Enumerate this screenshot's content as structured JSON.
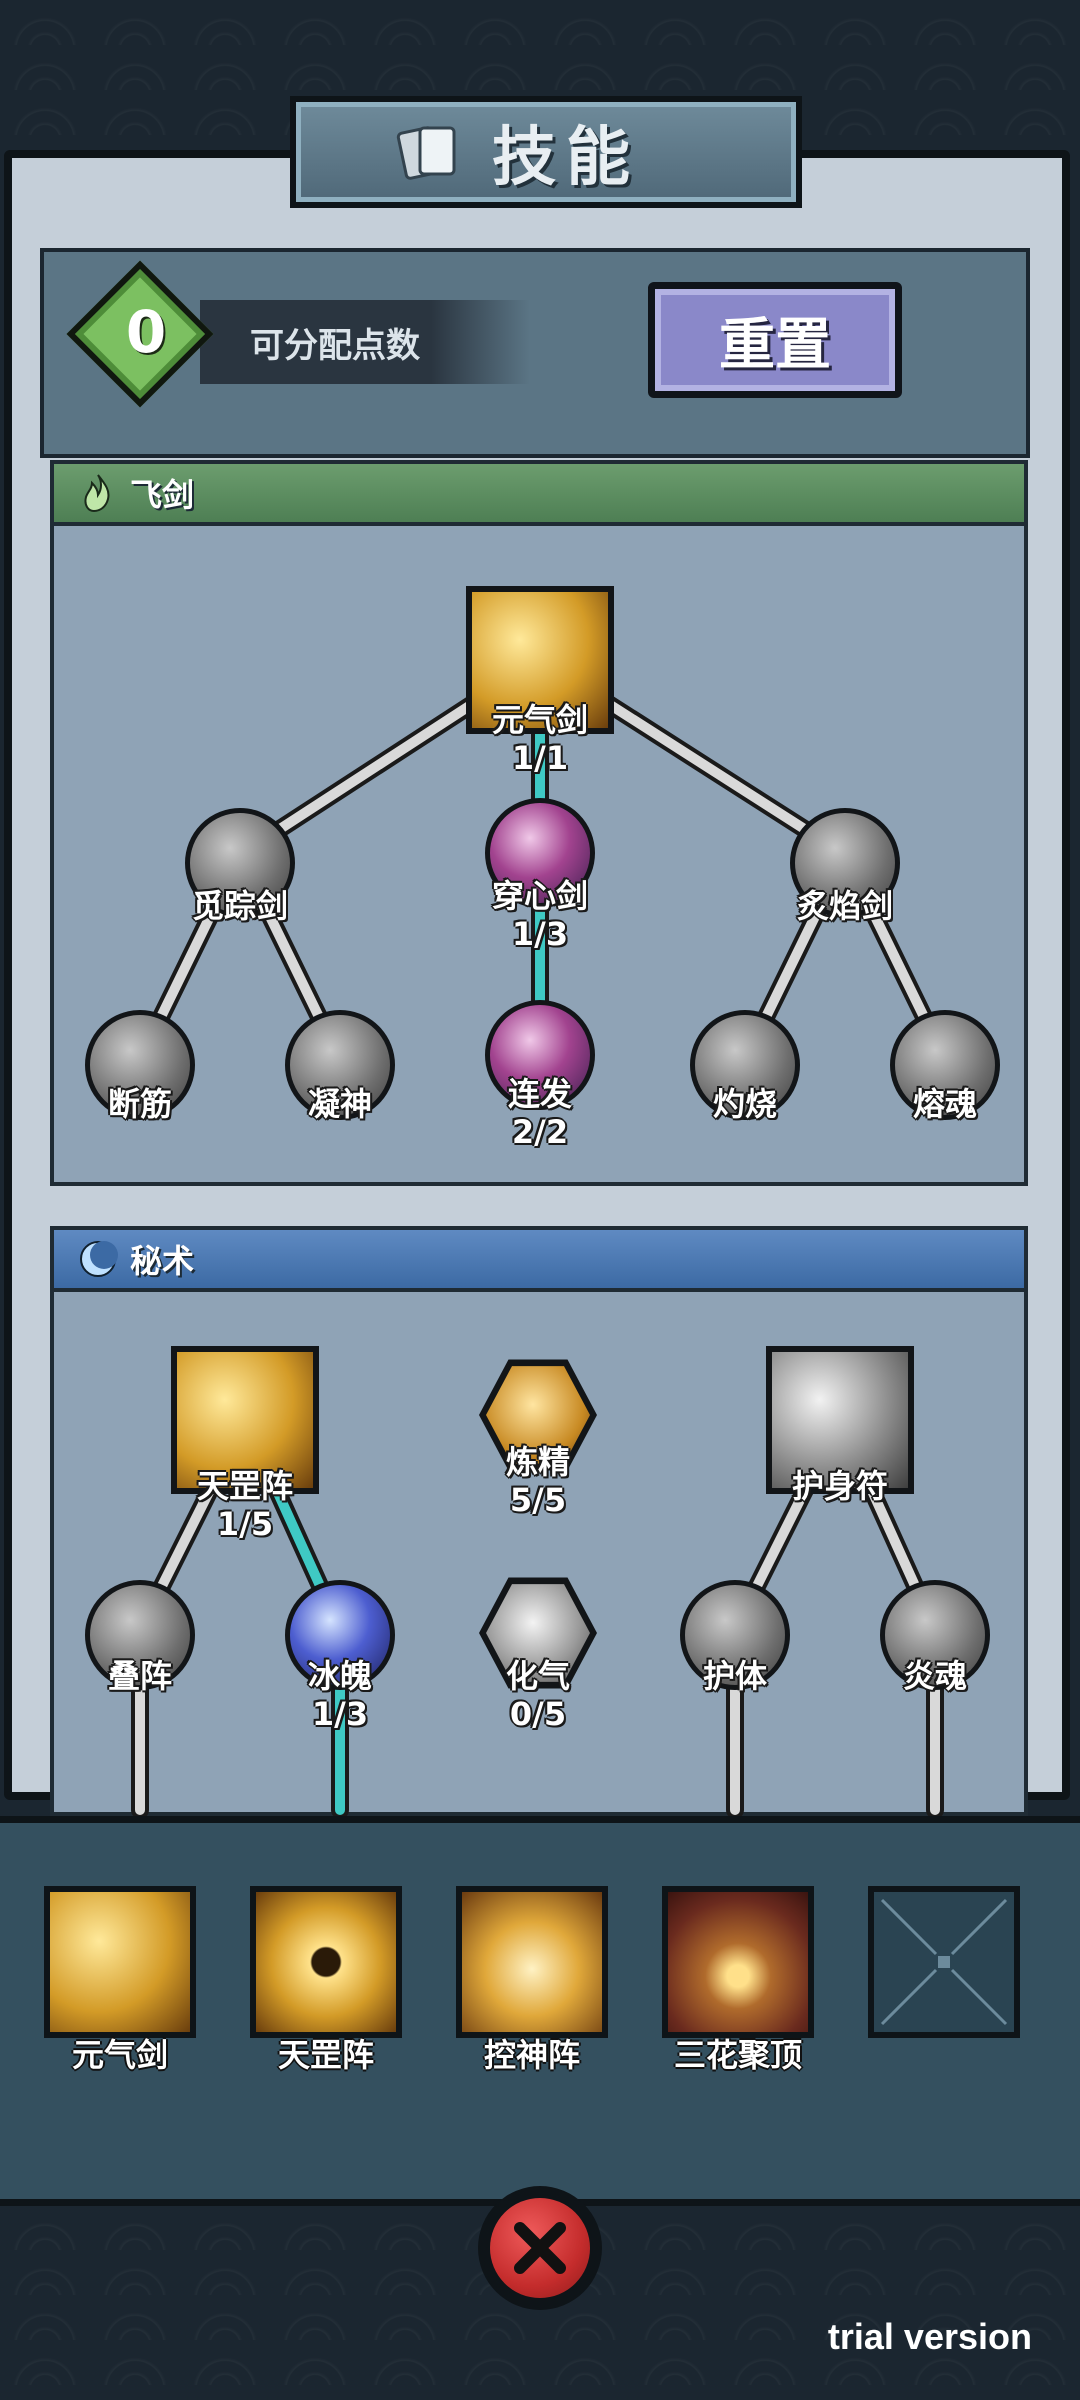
{
  "title": "技能",
  "points": {
    "value": "0",
    "label": "可分配点数"
  },
  "reset_label": "重置",
  "sections": {
    "flying_sword": {
      "title": "飞剑",
      "nodes": {
        "root": {
          "name": "元气剑",
          "level": "1/1"
        },
        "left": {
          "name": "觅踪剑"
        },
        "middle": {
          "name": "穿心剑",
          "level": "1/3"
        },
        "right": {
          "name": "炙焰剑"
        },
        "ll": {
          "name": "断筋"
        },
        "lr": {
          "name": "凝神"
        },
        "m": {
          "name": "连发",
          "level": "2/2"
        },
        "rl": {
          "name": "灼烧"
        },
        "rr": {
          "name": "熔魂"
        }
      }
    },
    "secret_art": {
      "title": "秘术",
      "nodes": {
        "tian": {
          "name": "天罡阵",
          "level": "1/5"
        },
        "lian": {
          "name": "炼精",
          "level": "5/5"
        },
        "hushenfu": {
          "name": "护身符"
        },
        "diezhen": {
          "name": "叠阵"
        },
        "bingpo": {
          "name": "冰魄",
          "level": "1/3"
        },
        "huaqi": {
          "name": "化气",
          "level": "0/5"
        },
        "huti": {
          "name": "护体"
        },
        "yanhun": {
          "name": "炎魂"
        }
      }
    }
  },
  "dock": [
    {
      "name": "元气剑"
    },
    {
      "name": "天罡阵"
    },
    {
      "name": "控神阵"
    },
    {
      "name": "三花聚顶"
    },
    {
      "name": ""
    }
  ],
  "watermark": "trial version",
  "colors": {
    "active_line": "#3fc9c4",
    "inactive_line": "#d9d9d9",
    "reset_button": "#8a88c9",
    "points_diamond": "#7cc061"
  }
}
